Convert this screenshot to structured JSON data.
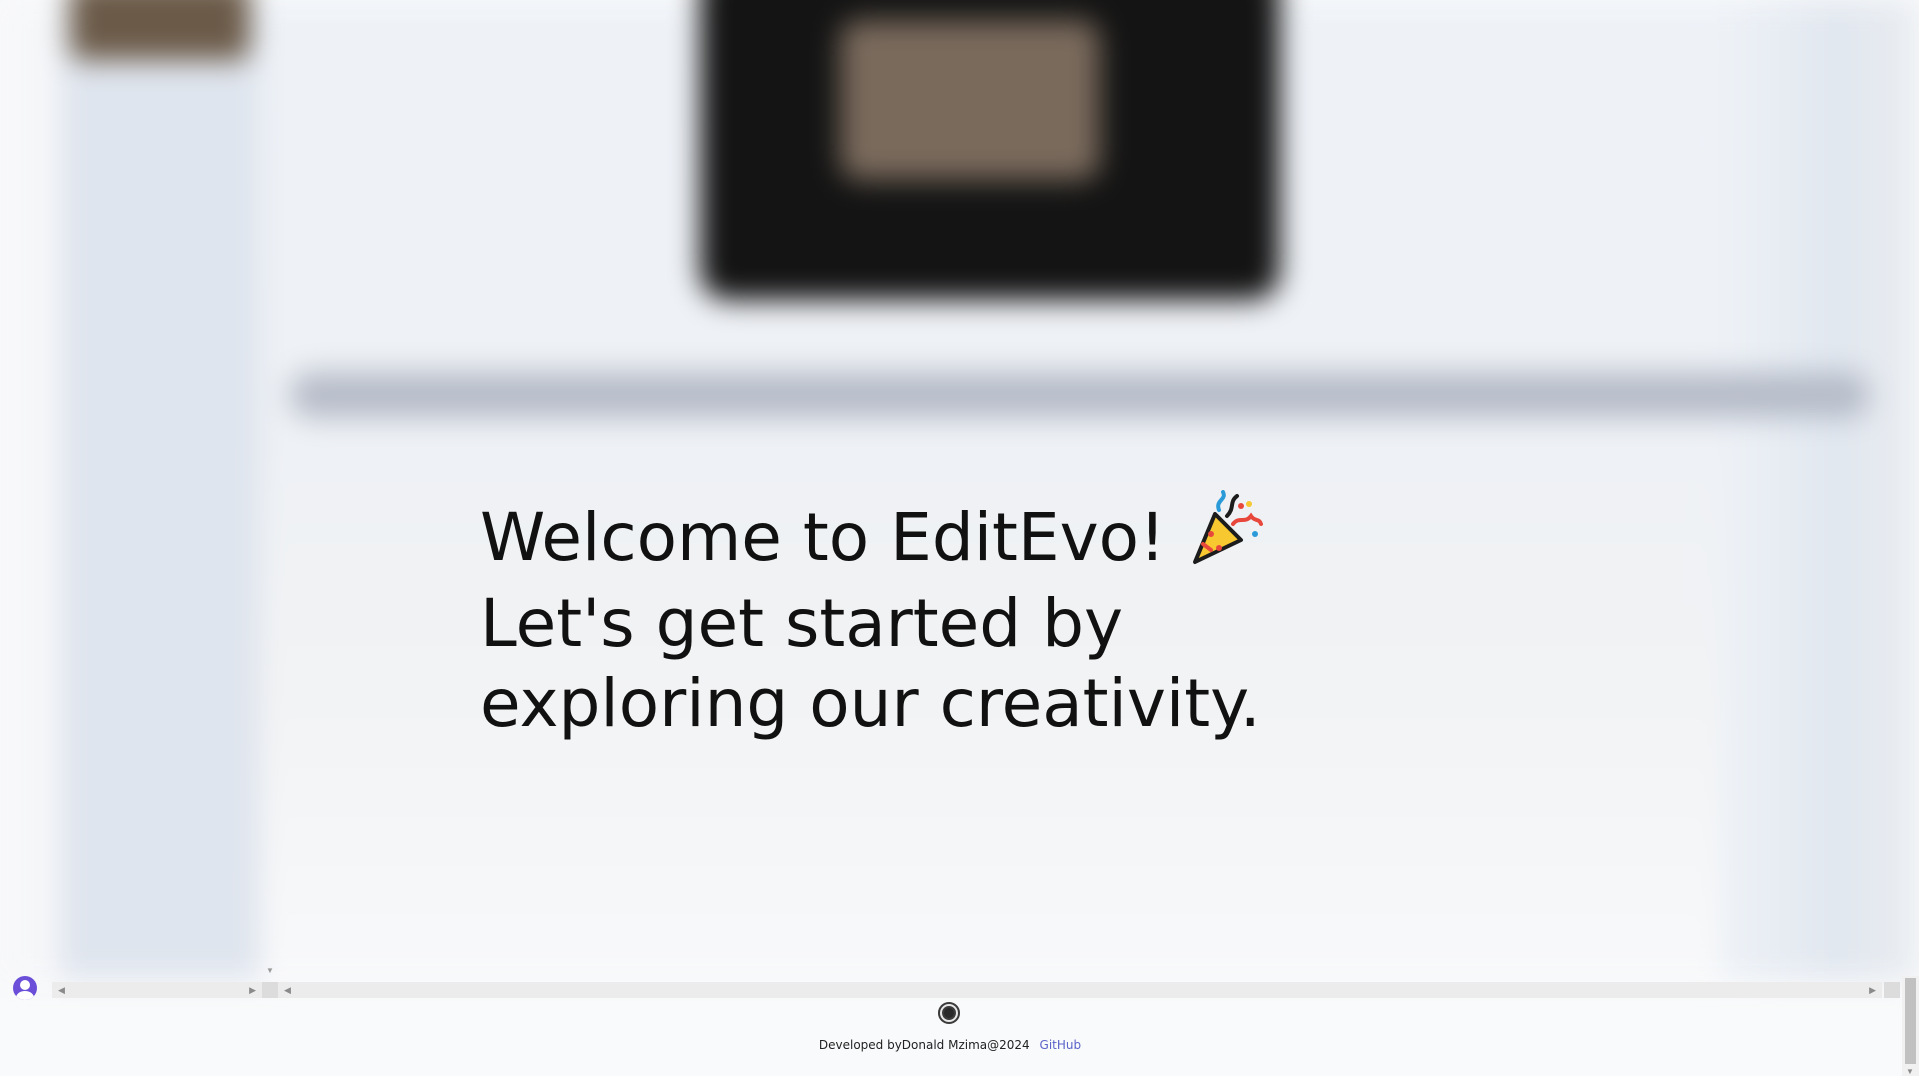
{
  "welcome": {
    "text_before": "Welcome to EditEvo! ",
    "emoji": "🎉",
    "text_after": " Let's get started by exploring our creativity."
  },
  "footer": {
    "credit": "Developed byDonald Mzima@2024",
    "link_label": "GitHub"
  },
  "icons": {
    "avatar": "user-avatar-icon",
    "party": "party-popper-icon",
    "record": "record-icon"
  },
  "colors": {
    "avatar": "#6b4fd8",
    "link": "#5b63c9",
    "text": "#111111"
  }
}
